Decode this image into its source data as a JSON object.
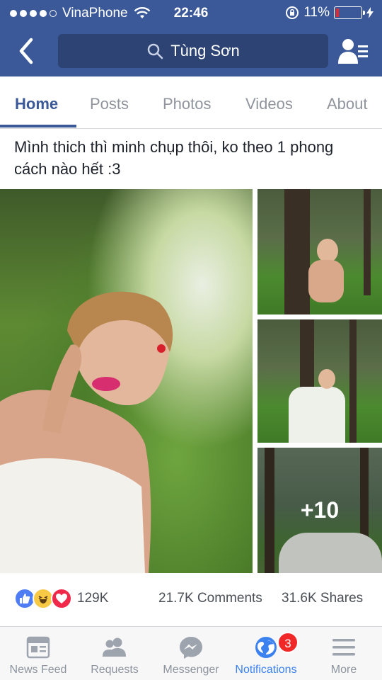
{
  "status_bar": {
    "carrier": "VinaPhone",
    "time": "22:46",
    "battery": "11%",
    "battery_level": 0.11
  },
  "header": {
    "search_label": "Tùng Sơn"
  },
  "tabs": [
    {
      "label": "Home",
      "active": true
    },
    {
      "label": "Posts",
      "active": false
    },
    {
      "label": "Photos",
      "active": false
    },
    {
      "label": "Videos",
      "active": false
    },
    {
      "label": "About",
      "active": false
    }
  ],
  "post": {
    "text": "Mình thich thì minh chụp thôi, ko theo 1 phong cách nào hết :3",
    "more_photos": "+10",
    "reaction_count": "129K",
    "comments": "21.7K Comments",
    "shares": "31.6K Shares"
  },
  "bottom_nav": [
    {
      "label": "News Feed",
      "icon": "news-feed-icon",
      "active": false
    },
    {
      "label": "Requests",
      "icon": "friend-requests-icon",
      "active": false
    },
    {
      "label": "Messenger",
      "icon": "messenger-icon",
      "active": false
    },
    {
      "label": "Notifications",
      "icon": "notifications-globe-icon",
      "active": true
    },
    {
      "label": "More",
      "icon": "menu-icon",
      "active": false
    }
  ],
  "notification_badge": "3",
  "colors": {
    "brand": "#3b5998",
    "active_tab": "#3b82f0",
    "badge": "#f02828"
  }
}
